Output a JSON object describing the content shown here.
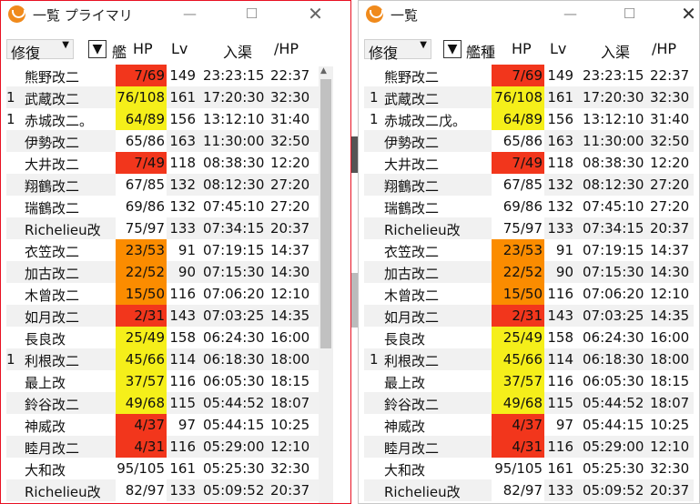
{
  "window1": {
    "title": "一覧 プライマリ",
    "sort_value": "修復",
    "columns": {
      "ship": "艦",
      "hp": "HP",
      "lv": "Lv",
      "repair": "入渠",
      "cond": "/HP"
    },
    "controls": {
      "minimize": "—",
      "maximize": "☐",
      "close": "✕"
    }
  },
  "window2": {
    "title": "一覧",
    "sort_value": "修復",
    "columns": {
      "ship": "艦種",
      "hp": "HP",
      "lv": "Lv",
      "repair": "入渠",
      "cond": "/HP"
    },
    "controls": {
      "minimize": "—",
      "maximize": "☐",
      "close": "✕"
    }
  },
  "colors": {
    "red": "#f2361c",
    "orange": "#fb8c00",
    "yellow": "#f5ef1a",
    "white": "#ffffff"
  },
  "ships1": [
    {
      "fleet": "",
      "name": "熊野改二",
      "hp": "7/69",
      "status": "red",
      "lv": "149",
      "repair": "23:23:15",
      "cond": "22:37"
    },
    {
      "fleet": "1",
      "name": "武蔵改二",
      "hp": "76/108",
      "status": "yellow",
      "lv": "161",
      "repair": "17:20:30",
      "cond": "32:30"
    },
    {
      "fleet": "1",
      "name": "赤城改二。",
      "hp": "64/89",
      "status": "yellow",
      "lv": "156",
      "repair": "13:12:10",
      "cond": "31:40"
    },
    {
      "fleet": "",
      "name": "伊勢改二",
      "hp": "65/86",
      "status": "white",
      "lv": "163",
      "repair": "11:30:00",
      "cond": "32:50"
    },
    {
      "fleet": "",
      "name": "大井改二",
      "hp": "7/49",
      "status": "red",
      "lv": "118",
      "repair": "08:38:30",
      "cond": "12:20"
    },
    {
      "fleet": "",
      "name": "翔鶴改二",
      "hp": "67/85",
      "status": "white",
      "lv": "132",
      "repair": "08:12:30",
      "cond": "27:20"
    },
    {
      "fleet": "",
      "name": "瑞鶴改二",
      "hp": "69/86",
      "status": "white",
      "lv": "132",
      "repair": "07:45:10",
      "cond": "27:20"
    },
    {
      "fleet": "",
      "name": "Richelieu改",
      "hp": "75/97",
      "status": "white",
      "lv": "133",
      "repair": "07:34:15",
      "cond": "20:37"
    },
    {
      "fleet": "",
      "name": "衣笠改二",
      "hp": "23/53",
      "status": "orange",
      "lv": "91",
      "repair": "07:19:15",
      "cond": "14:37"
    },
    {
      "fleet": "",
      "name": "加古改二",
      "hp": "22/52",
      "status": "orange",
      "lv": "90",
      "repair": "07:15:30",
      "cond": "14:30"
    },
    {
      "fleet": "",
      "name": "木曾改二",
      "hp": "15/50",
      "status": "orange",
      "lv": "116",
      "repair": "07:06:20",
      "cond": "12:10"
    },
    {
      "fleet": "",
      "name": "如月改二",
      "hp": "2/31",
      "status": "red",
      "lv": "143",
      "repair": "07:03:25",
      "cond": "14:35"
    },
    {
      "fleet": "",
      "name": "長良改",
      "hp": "25/49",
      "status": "yellow",
      "lv": "158",
      "repair": "06:24:30",
      "cond": "16:00"
    },
    {
      "fleet": "1",
      "name": "利根改二",
      "hp": "45/66",
      "status": "yellow",
      "lv": "114",
      "repair": "06:18:30",
      "cond": "18:00"
    },
    {
      "fleet": "",
      "name": "最上改",
      "hp": "37/57",
      "status": "yellow",
      "lv": "116",
      "repair": "06:05:30",
      "cond": "18:15"
    },
    {
      "fleet": "",
      "name": "鈴谷改二",
      "hp": "49/68",
      "status": "yellow",
      "lv": "115",
      "repair": "05:44:52",
      "cond": "18:07"
    },
    {
      "fleet": "",
      "name": "神威改",
      "hp": "4/37",
      "status": "red",
      "lv": "97",
      "repair": "05:44:15",
      "cond": "10:25"
    },
    {
      "fleet": "",
      "name": "睦月改二",
      "hp": "4/31",
      "status": "red",
      "lv": "116",
      "repair": "05:29:00",
      "cond": "12:10"
    },
    {
      "fleet": "",
      "name": "大和改",
      "hp": "95/105",
      "status": "white",
      "lv": "161",
      "repair": "05:25:30",
      "cond": "32:30"
    },
    {
      "fleet": "",
      "name": "Richelieu改",
      "hp": "82/97",
      "status": "white",
      "lv": "133",
      "repair": "05:09:52",
      "cond": "20:37"
    }
  ],
  "ships2": [
    {
      "fleet": "",
      "name": "熊野改二",
      "hp": "7/69",
      "status": "red",
      "lv": "149",
      "repair": "23:23:15",
      "cond": "22:37"
    },
    {
      "fleet": "1",
      "name": "武蔵改二",
      "hp": "76/108",
      "status": "yellow",
      "lv": "161",
      "repair": "17:20:30",
      "cond": "32:30"
    },
    {
      "fleet": "1",
      "name": "赤城改二戊。",
      "hp": "64/89",
      "status": "yellow",
      "lv": "156",
      "repair": "13:12:10",
      "cond": "31:40"
    },
    {
      "fleet": "",
      "name": "伊勢改二",
      "hp": "65/86",
      "status": "white",
      "lv": "163",
      "repair": "11:30:00",
      "cond": "32:50"
    },
    {
      "fleet": "",
      "name": "大井改二",
      "hp": "7/49",
      "status": "red",
      "lv": "118",
      "repair": "08:38:30",
      "cond": "12:20"
    },
    {
      "fleet": "",
      "name": "翔鶴改二",
      "hp": "67/85",
      "status": "white",
      "lv": "132",
      "repair": "08:12:30",
      "cond": "27:20"
    },
    {
      "fleet": "",
      "name": "瑞鶴改二",
      "hp": "69/86",
      "status": "white",
      "lv": "132",
      "repair": "07:45:10",
      "cond": "27:20"
    },
    {
      "fleet": "",
      "name": "Richelieu改",
      "hp": "75/97",
      "status": "white",
      "lv": "133",
      "repair": "07:34:15",
      "cond": "20:37"
    },
    {
      "fleet": "",
      "name": "衣笠改二",
      "hp": "23/53",
      "status": "orange",
      "lv": "91",
      "repair": "07:19:15",
      "cond": "14:37"
    },
    {
      "fleet": "",
      "name": "加古改二",
      "hp": "22/52",
      "status": "orange",
      "lv": "90",
      "repair": "07:15:30",
      "cond": "14:30"
    },
    {
      "fleet": "",
      "name": "木曾改二",
      "hp": "15/50",
      "status": "orange",
      "lv": "116",
      "repair": "07:06:20",
      "cond": "12:10"
    },
    {
      "fleet": "",
      "name": "如月改二",
      "hp": "2/31",
      "status": "red",
      "lv": "143",
      "repair": "07:03:25",
      "cond": "14:35"
    },
    {
      "fleet": "",
      "name": "長良改",
      "hp": "25/49",
      "status": "yellow",
      "lv": "158",
      "repair": "06:24:30",
      "cond": "16:00"
    },
    {
      "fleet": "1",
      "name": "利根改二",
      "hp": "45/66",
      "status": "yellow",
      "lv": "114",
      "repair": "06:18:30",
      "cond": "18:00"
    },
    {
      "fleet": "",
      "name": "最上改",
      "hp": "37/57",
      "status": "yellow",
      "lv": "116",
      "repair": "06:05:30",
      "cond": "18:15"
    },
    {
      "fleet": "",
      "name": "鈴谷改二",
      "hp": "49/68",
      "status": "yellow",
      "lv": "115",
      "repair": "05:44:52",
      "cond": "18:07"
    },
    {
      "fleet": "",
      "name": "神威改",
      "hp": "4/37",
      "status": "red",
      "lv": "97",
      "repair": "05:44:15",
      "cond": "10:25"
    },
    {
      "fleet": "",
      "name": "睦月改二",
      "hp": "4/31",
      "status": "red",
      "lv": "116",
      "repair": "05:29:00",
      "cond": "12:10"
    },
    {
      "fleet": "",
      "name": "大和改",
      "hp": "95/105",
      "status": "white",
      "lv": "161",
      "repair": "05:25:30",
      "cond": "32:30"
    },
    {
      "fleet": "",
      "name": "Richelieu改",
      "hp": "82/97",
      "status": "white",
      "lv": "133",
      "repair": "05:09:52",
      "cond": "20:37"
    }
  ]
}
